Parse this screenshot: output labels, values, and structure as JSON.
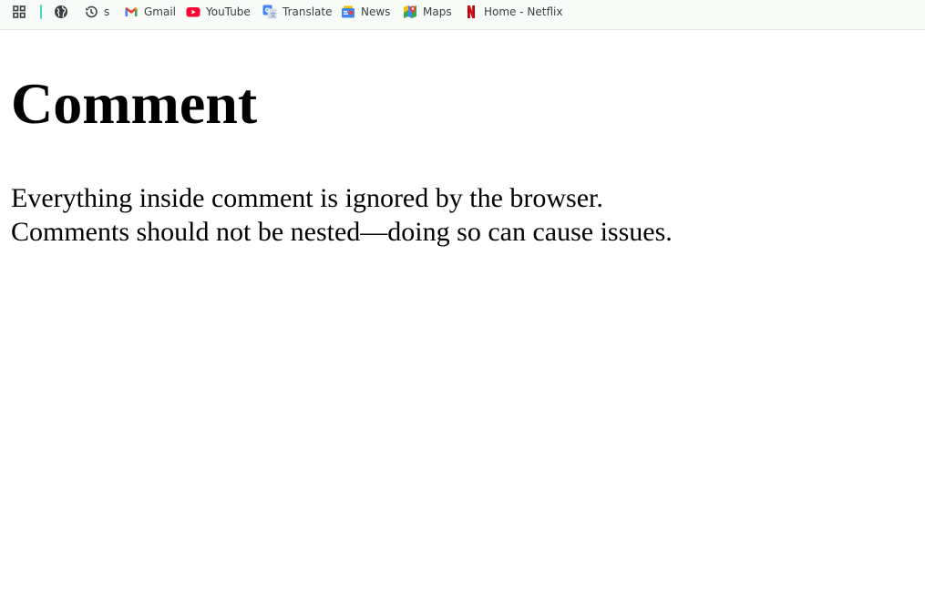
{
  "bookmarks": {
    "apps_icon": "apps-grid-icon",
    "globe_icon": "globe-icon",
    "history": {
      "label": "s",
      "icon": "history-icon"
    },
    "gmail": {
      "label": "Gmail",
      "icon": "gmail-icon"
    },
    "youtube": {
      "label": "YouTube",
      "icon": "youtube-icon"
    },
    "translate": {
      "label": "Translate",
      "icon": "google-translate-icon"
    },
    "news": {
      "label": "News",
      "icon": "google-news-icon"
    },
    "maps": {
      "label": "Maps",
      "icon": "google-maps-icon"
    },
    "netflix": {
      "label": "Home - Netflix",
      "icon": "netflix-icon"
    }
  },
  "colors": {
    "separator": "#43d6c3",
    "youtube": "#ff0033",
    "netflix": "#e50914",
    "bar_background": "#f8fbf8"
  },
  "page": {
    "heading": "Comment",
    "line1": "Everything inside comment is ignored by the browser.",
    "line2": "Comments should not be nested—doing so can cause issues."
  }
}
